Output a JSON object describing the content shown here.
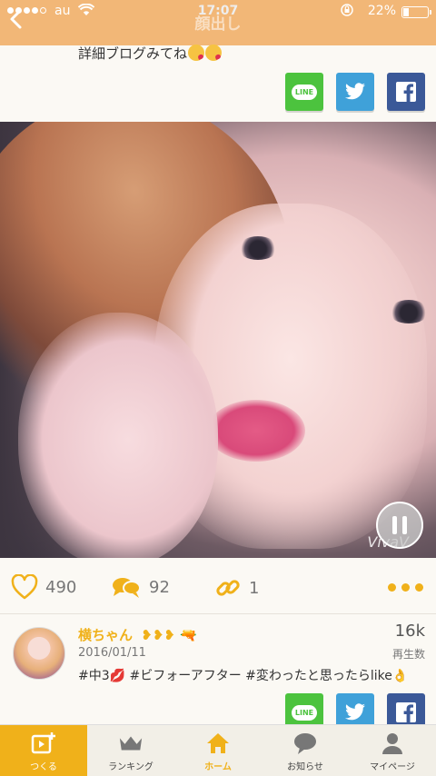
{
  "status_bar": {
    "carrier": "au",
    "time": "17:07",
    "battery_percent": "22%",
    "battery_level": 0.22
  },
  "nav": {
    "title": "顔出し"
  },
  "previous_post": {
    "text": "詳細ブログみてね"
  },
  "share": {
    "line_label": "LINE",
    "twitter_label": "t",
    "facebook_label": "f"
  },
  "video": {
    "watermark": "VivaV"
  },
  "actions": {
    "likes": "490",
    "comments": "92",
    "shares": "1"
  },
  "post": {
    "username": "横ちゃん",
    "date": "2016/01/11",
    "tags": "#中3💋 #ビフォーアフター #変わったと思ったらlike👌",
    "views": "16k",
    "views_label": "再生数"
  },
  "tabs": [
    {
      "label": "つくる"
    },
    {
      "label": "ランキング"
    },
    {
      "label": "ホーム"
    },
    {
      "label": "お知らせ"
    },
    {
      "label": "マイページ"
    }
  ],
  "colors": {
    "accent": "#f0b11a",
    "nav_bg": "#f2b777",
    "line": "#4cc33e",
    "twitter": "#3fa1d9",
    "facebook": "#3b5998"
  }
}
